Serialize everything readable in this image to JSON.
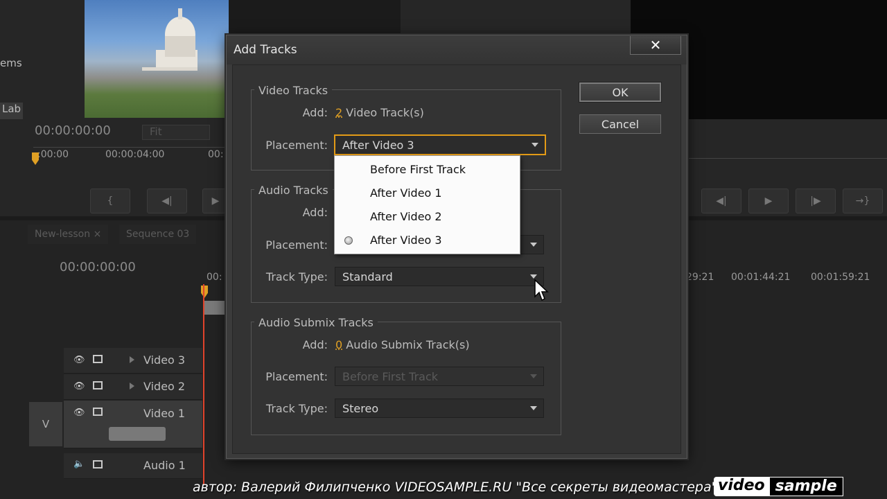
{
  "background": {
    "source_monitor": {
      "partial_label_top": "ems",
      "partial_label_lab": "Lab",
      "timecode": "00:00:00:00",
      "fit_label": "Fit",
      "ruler_ticks": [
        ":00:00",
        "00:00:04:00",
        "00:"
      ]
    },
    "timeline": {
      "tabs": [
        "New-lesson",
        "Sequence 03"
      ],
      "timecode": "00:00:00:00",
      "ruler_start": "00:",
      "ruler_ticks_right": [
        "29:21",
        "00:01:44:21",
        "00:01:59:21"
      ],
      "tracks": [
        {
          "name": "Video 3"
        },
        {
          "name": "Video 2"
        },
        {
          "name": "Video 1"
        },
        {
          "name": "Audio 1"
        }
      ],
      "target_label": "V"
    }
  },
  "dialog": {
    "title": "Add Tracks",
    "close_glyph": "✕",
    "ok_label": "OK",
    "cancel_label": "Cancel",
    "video": {
      "legend": "Video Tracks",
      "add_label": "Add:",
      "add_count": "2",
      "add_suffix": "Video Track(s)",
      "placement_label": "Placement:",
      "placement_value": "After Video 3"
    },
    "audio": {
      "legend": "Audio Tracks",
      "add_label": "Add:",
      "placement_label": "Placement:",
      "track_type_label": "Track Type:",
      "track_type_value": "Standard"
    },
    "submix": {
      "legend": "Audio Submix Tracks",
      "add_label": "Add:",
      "add_count": "0",
      "add_suffix": "Audio Submix Track(s)",
      "placement_label": "Placement:",
      "placement_value": "Before First Track",
      "track_type_label": "Track Type:",
      "track_type_value": "Stereo"
    },
    "placement_options": [
      {
        "label": "Before First Track",
        "selected": false
      },
      {
        "label": "After Video 1",
        "selected": false
      },
      {
        "label": "After Video 2",
        "selected": false
      },
      {
        "label": "After Video 3",
        "selected": true
      }
    ]
  },
  "watermark": {
    "credit": "автор: Валерий Филипченко   VIDEOSAMPLE.RU   \"Все секреты видеомастера\"",
    "logo_left": "video",
    "logo_right": "sample"
  },
  "colors": {
    "accent_orange": "#e39b17",
    "playhead_red": "#e1432b"
  }
}
